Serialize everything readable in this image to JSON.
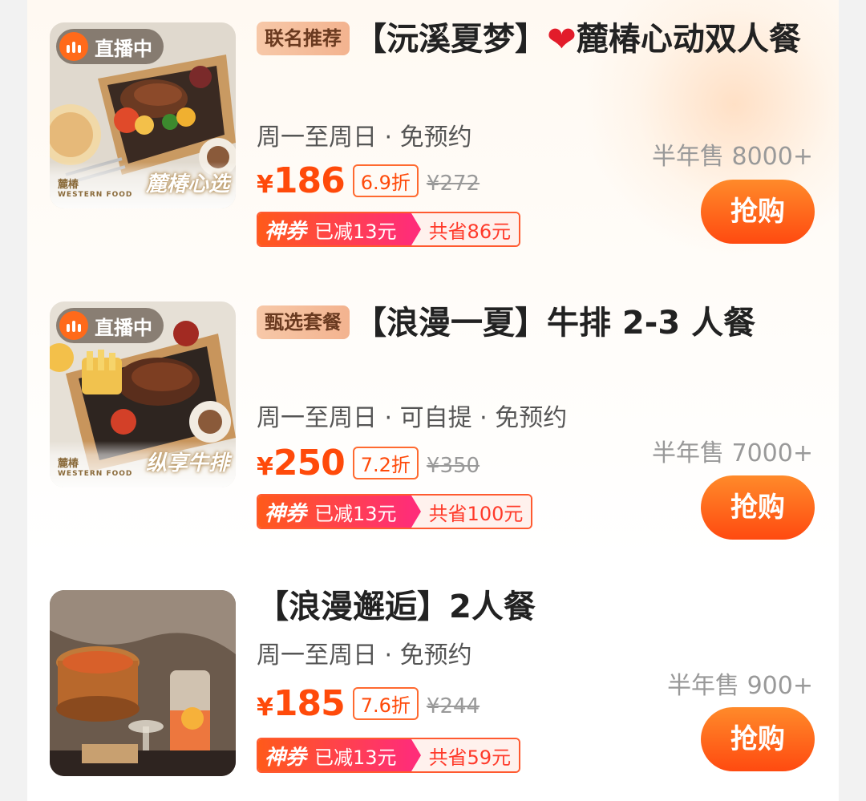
{
  "live_badge": "直播中",
  "items": [
    {
      "tag": "联名推荐",
      "title_a": "【沅溪夏梦】",
      "title_b": "麓椿心动双人餐",
      "subtitle": "周一至周日 · 免预约",
      "sold": "半年售 8000+",
      "price_symbol": "¥",
      "price": "186",
      "discount": "6.9折",
      "original": "¥272",
      "coupon_label": "神券",
      "coupon_reduce": "已减13元",
      "coupon_save": "共省86元",
      "buy_label": "抢购",
      "brand_slogan": "麓椿心选",
      "brand_name": "麓椿",
      "brand_sub": "WESTERN FOOD"
    },
    {
      "tag": "甄选套餐",
      "title_a": "【浪漫一夏】牛排 2-3 人餐",
      "subtitle": "周一至周日 · 可自提 · 免预约",
      "sold": "半年售 7000+",
      "price_symbol": "¥",
      "price": "250",
      "discount": "7.2折",
      "original": "¥350",
      "coupon_label": "神券",
      "coupon_reduce": "已减13元",
      "coupon_save": "共省100元",
      "buy_label": "抢购",
      "brand_slogan": "纵享牛排",
      "brand_name": "麓椿",
      "brand_sub": "WESTERN FOOD"
    },
    {
      "title_a": "【浪漫邂逅】2人餐",
      "subtitle": "周一至周日 · 免预约",
      "sold": "半年售 900+",
      "price_symbol": "¥",
      "price": "185",
      "discount": "7.6折",
      "original": "¥244",
      "coupon_label": "神券",
      "coupon_reduce": "已减13元",
      "coupon_save": "共省59元",
      "buy_label": "抢购"
    }
  ],
  "colors": {
    "accent": "#ff4a0a",
    "button": "#ff6a1a",
    "coupon_gradient_start": "#ff5a1a",
    "coupon_gradient_end": "#ff2d78"
  }
}
